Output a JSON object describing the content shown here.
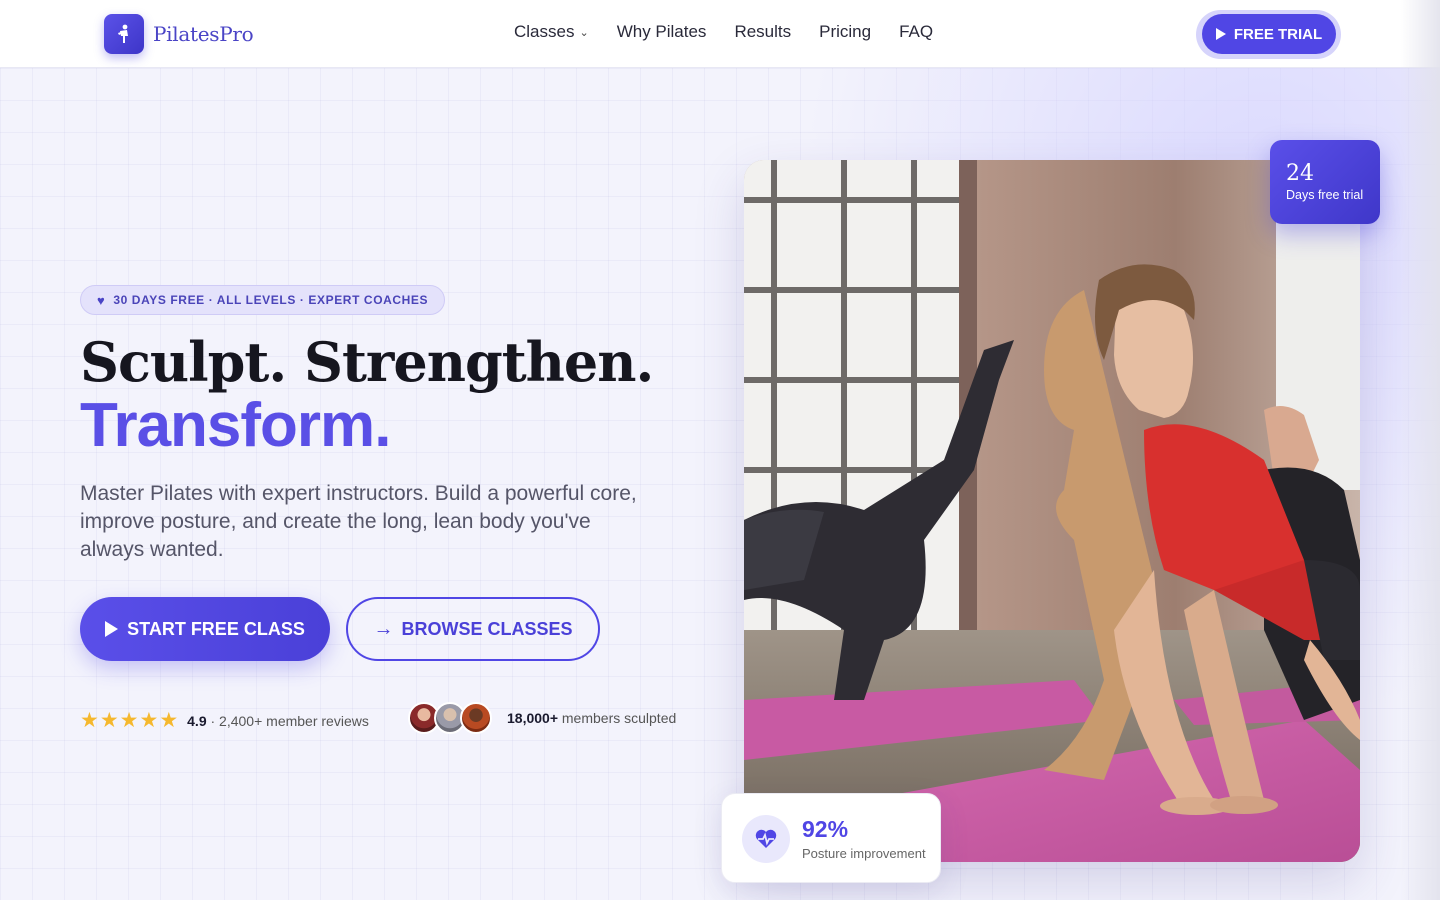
{
  "brand": {
    "name": "PilatesPro"
  },
  "nav": {
    "links": [
      {
        "label": "Classes",
        "has_dropdown": true
      },
      {
        "label": "Why Pilates"
      },
      {
        "label": "Results"
      },
      {
        "label": "Pricing"
      },
      {
        "label": "FAQ"
      }
    ],
    "cta_label": "FREE TRIAL"
  },
  "hero": {
    "badge": "30 DAYS FREE · ALL LEVELS · EXPERT COACHES",
    "title_line1": "Sculpt. Strengthen.",
    "title_line2": "Transform.",
    "lead": "Master Pilates with expert instructors. Build a powerful core, improve posture, and create the long, lean body you've always wanted.",
    "primary_cta": "START FREE CLASS",
    "secondary_cta": "BROWSE CLASSES",
    "rating_value": "4.9",
    "rating_text": " · 2,400+ member reviews",
    "stars": 5,
    "members_count": "18,000+",
    "members_text": " members sculpted"
  },
  "cards": {
    "days_value": "24",
    "days_label": "Days free trial",
    "stat_value": "92%",
    "stat_label": "Posture improvement"
  },
  "colors": {
    "accent": "#5046e5",
    "star": "#f5b82e",
    "heading": "#16161f"
  },
  "icons": [
    "figure-icon",
    "chevron-down-icon",
    "play-icon",
    "heart-icon",
    "arrow-right-icon",
    "star-icon",
    "heartbeat-icon"
  ]
}
